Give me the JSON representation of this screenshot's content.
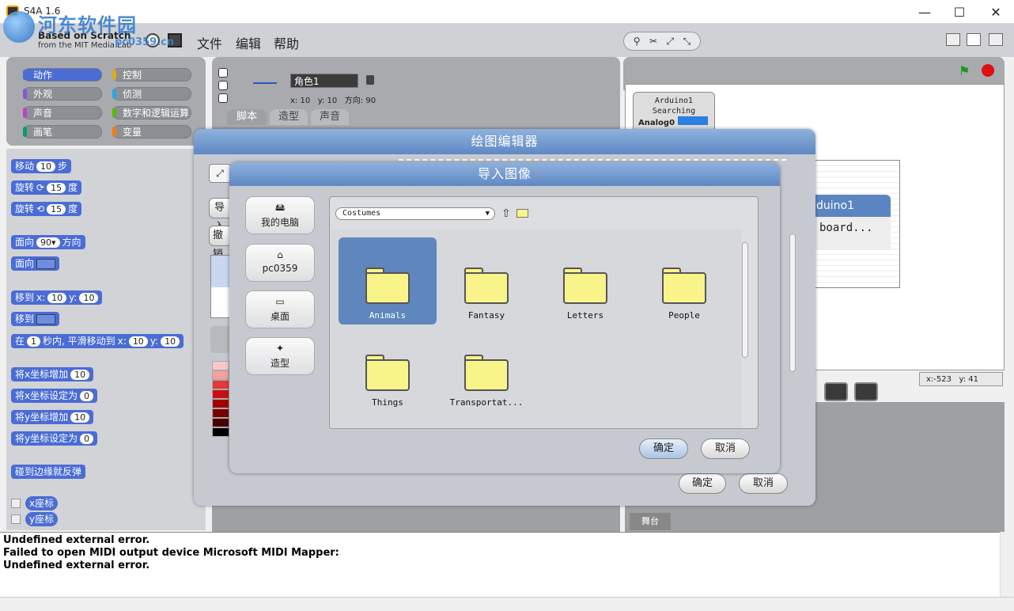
{
  "window": {
    "title": "S4A 1.6",
    "minimize": "—",
    "maximize": "☐",
    "close": "✕"
  },
  "watermark": {
    "main": "河东软件园",
    "sub": "pc0359.cn"
  },
  "toolbar": {
    "logo_line1": "Based on Scratch",
    "logo_line2": "from the MIT Media Lab",
    "menus": [
      "文件",
      "编辑",
      "帮助"
    ],
    "globe_icon": "globe-icon",
    "save_icon": "save-icon"
  },
  "categories": [
    {
      "label": "动作",
      "color": "#4a6cd4"
    },
    {
      "label": "控制",
      "color": "#e1a91a"
    },
    {
      "label": "外观",
      "color": "#8a55d7"
    },
    {
      "label": "侦测",
      "color": "#2ca5e2"
    },
    {
      "label": "声音",
      "color": "#bb42c3"
    },
    {
      "label": "数字和逻辑运算",
      "color": "#5cb712"
    },
    {
      "label": "画笔",
      "color": "#0e9a6c"
    },
    {
      "label": "变量",
      "color": "#ee7d16"
    }
  ],
  "blocks": {
    "move": {
      "pre": "移动",
      "val": "10",
      "post": "步"
    },
    "turn_cw": {
      "pre": "旋转",
      "icon": "⟳",
      "val": "15",
      "post": "度"
    },
    "turn_ccw": {
      "pre": "旋转",
      "icon": "⟲",
      "val": "15",
      "post": "度"
    },
    "point_dir": {
      "pre": "面向",
      "val": "90▾",
      "post": "方向"
    },
    "point_towards": {
      "pre": "面向"
    },
    "goto_xy": {
      "pre": "移到",
      "x_label": "x:",
      "x": "10",
      "y_label": "y:",
      "y": "10"
    },
    "goto": {
      "pre": "移到"
    },
    "glide": {
      "pre": "在",
      "secs": "1",
      "mid": "秒内, 平滑移动到",
      "x_label": "x:",
      "x": "10",
      "y_label": "y:",
      "y": "10"
    },
    "change_x": {
      "pre": "将x坐标增加",
      "val": "10"
    },
    "set_x": {
      "pre": "将x坐标设定为",
      "val": "0"
    },
    "change_y": {
      "pre": "将y坐标增加",
      "val": "10"
    },
    "set_y": {
      "pre": "将y坐标设定为",
      "val": "0"
    },
    "bounce": {
      "pre": "碰到边缘就反弹"
    },
    "x_pos": {
      "pre": "x座标"
    },
    "y_pos": {
      "pre": "y座标"
    }
  },
  "sprite": {
    "name": "角色1",
    "x_label": "x:",
    "x": "10",
    "y_label": "y:",
    "y": "10",
    "dir_label": "方向:",
    "dir": "90"
  },
  "tabs": [
    "脚本",
    "造型",
    "声音"
  ],
  "stage": {
    "arduino_name": "Arduino1",
    "arduino_status": "Searching",
    "analog_label": "Analog0",
    "arduino_box_title": "duino1",
    "arduino_box_text": "board...",
    "coord_x_label": "x:",
    "coord_x": "-523",
    "coord_y_label": "y:",
    "coord_y": "41",
    "stage_tab": "舞台"
  },
  "console": [
    "Undefined external error.",
    "Failed to open MIDI output device Microsoft MIDI Mapper:",
    "Undefined external error."
  ],
  "paint_editor": {
    "title": "绘图编辑器",
    "import_label": "导入",
    "undo_label": "撤销",
    "ok": "确定",
    "cancel": "取消",
    "palette": [
      "#f7c8c8",
      "#f2a0a0",
      "#e03a3a",
      "#c81010",
      "#a00000",
      "#7a0000",
      "#4a0000",
      "#000000"
    ]
  },
  "import_dialog": {
    "title": "导入图像",
    "locations": [
      {
        "label": "我的电脑",
        "icon": "computer-icon"
      },
      {
        "label": "pc0359",
        "icon": "home-icon"
      },
      {
        "label": "桌面",
        "icon": "desktop-icon"
      },
      {
        "label": "造型",
        "icon": "costumes-icon"
      }
    ],
    "directory": "Costumes",
    "folders": [
      {
        "name": "Animals",
        "selected": true
      },
      {
        "name": "Fantasy",
        "selected": false
      },
      {
        "name": "Letters",
        "selected": false
      },
      {
        "name": "People",
        "selected": false
      },
      {
        "name": "Things",
        "selected": false
      },
      {
        "name": "Transportat...",
        "selected": false
      }
    ],
    "ok": "确定",
    "cancel": "取消"
  }
}
